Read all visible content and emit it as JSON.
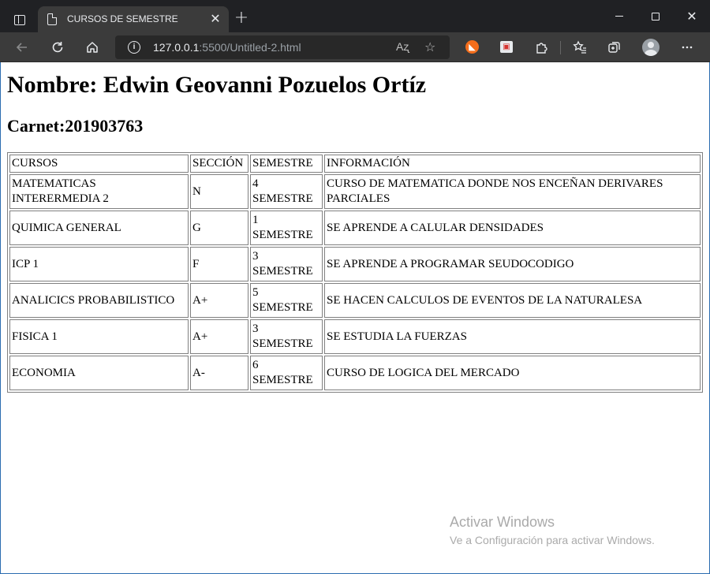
{
  "browser": {
    "tab_title": "CURSOS DE SEMESTRE",
    "tab_close": "✕",
    "new_tab": "+",
    "url_host": "127.0.0.1",
    "url_rest": ":5500/Untitled-2.html",
    "read_aloud": "Aʐ",
    "favorite": "☆",
    "window_close": "✕"
  },
  "page": {
    "title": "Nombre: Edwin Geovanni Pozuelos Ortíz",
    "subtitle": "Carnet:201903763",
    "table": {
      "headers": [
        "CURSOS",
        "SECCIÓN",
        "SEMESTRE",
        "INFORMACIÓN"
      ],
      "rows": [
        [
          "MATEMATICAS INTERERMEDIA 2",
          "N",
          "4 SEMESTRE",
          "CURSO DE MATEMATICA DONDE NOS ENCEÑAN DERIVARES PARCIALES"
        ],
        [
          "QUIMICA GENERAL",
          "G",
          "1 SEMESTRE",
          "SE APRENDE A CALULAR DENSIDADES"
        ],
        [
          "ICP 1",
          "F",
          "3 SEMESTRE",
          "SE APRENDE A PROGRAMAR SEUDOCODIGO"
        ],
        [
          "ANALICICS PROBABILISTICO",
          "A+",
          "5 SEMESTRE",
          "SE HACEN CALCULOS DE EVENTOS DE LA NATURALESA"
        ],
        [
          "FISICA 1",
          "A+",
          "3 SEMESTRE",
          "SE ESTUDIA LA FUERZAS"
        ],
        [
          "ECONOMIA",
          "A-",
          "6 SEMESTRE",
          "CURSO DE LOGICA DEL MERCADO"
        ]
      ]
    }
  },
  "watermark": {
    "title": "Activar Windows",
    "subtitle": "Ve a Configuración para activar Windows."
  }
}
